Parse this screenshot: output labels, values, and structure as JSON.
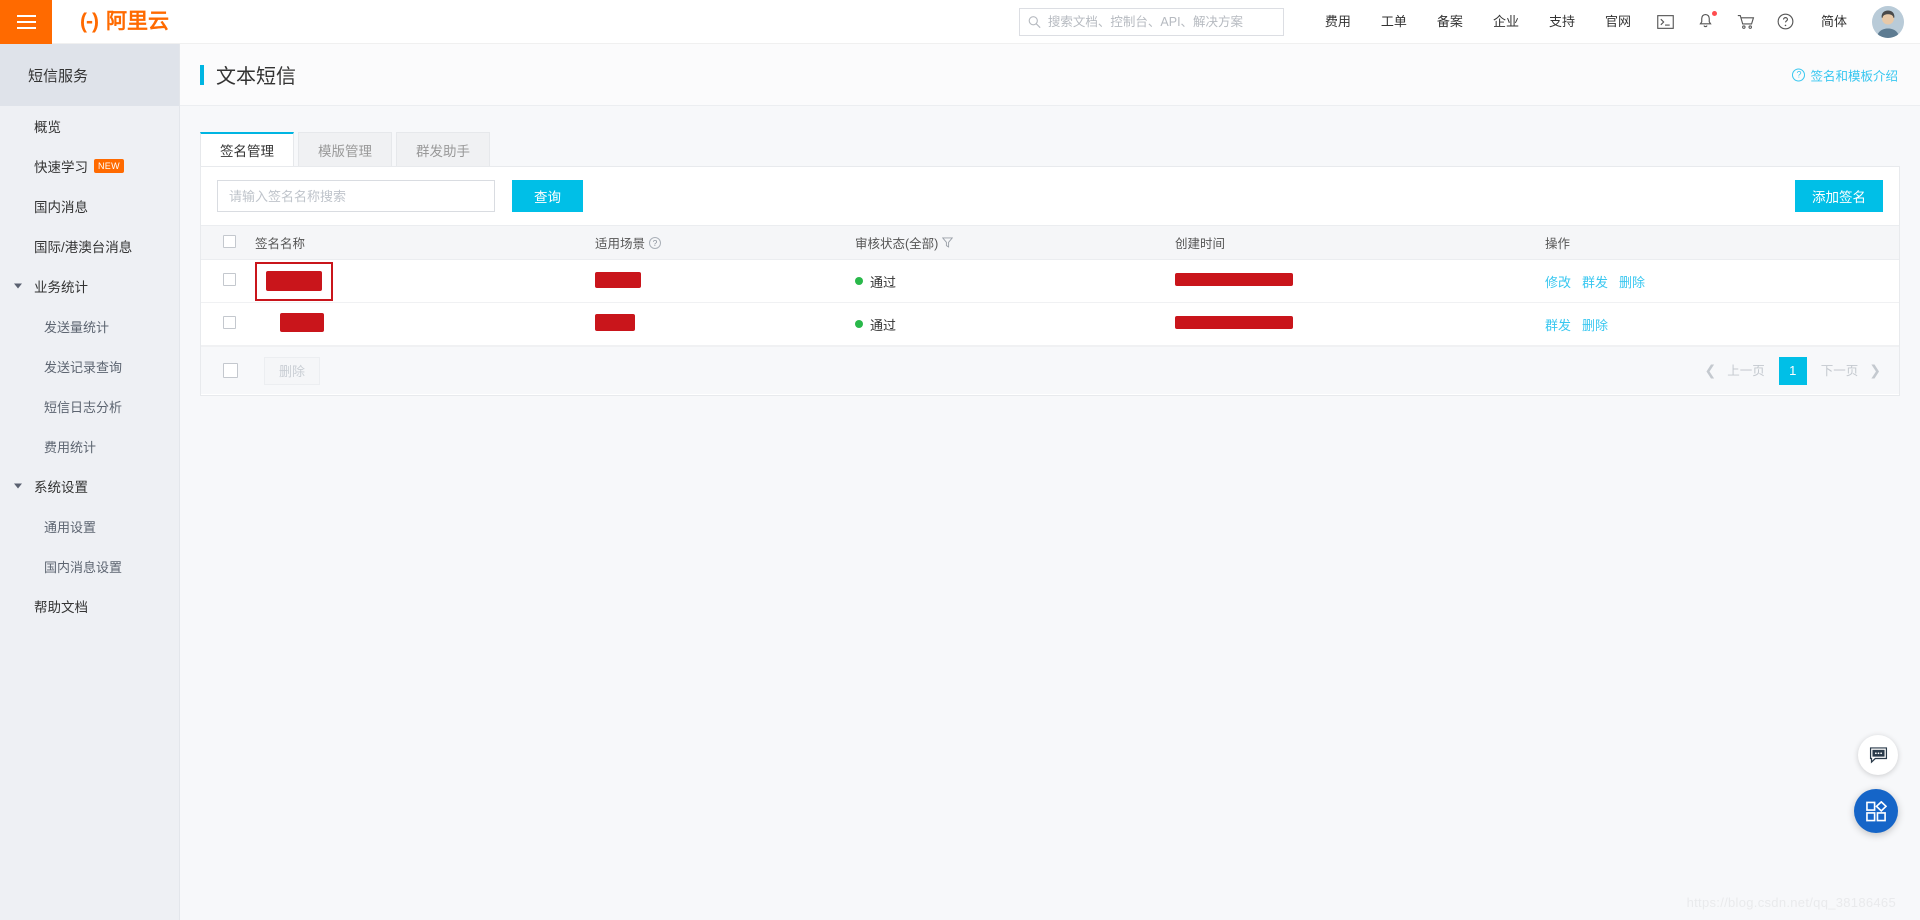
{
  "header": {
    "menu_icon": "hamburger-icon",
    "brand_mark": "(-)",
    "brand_name": "阿里云",
    "search_placeholder": "搜索文档、控制台、API、解决方案",
    "search_value": "",
    "search_icon": "search-icon",
    "nav_links": [
      "费用",
      "工单",
      "备案",
      "企业",
      "支持",
      "官网"
    ],
    "icons": [
      "terminal-icon",
      "bell-icon",
      "cart-icon",
      "help-icon"
    ],
    "language": "简体",
    "avatar": "user-avatar"
  },
  "sidebar": {
    "title": "短信服务",
    "items": [
      {
        "label": "概览",
        "type": "item"
      },
      {
        "label": "快速学习",
        "type": "item",
        "tag": "NEW"
      },
      {
        "label": "国内消息",
        "type": "item"
      },
      {
        "label": "国际/港澳台消息",
        "type": "item"
      },
      {
        "label": "业务统计",
        "type": "group"
      },
      {
        "label": "发送量统计",
        "type": "sub"
      },
      {
        "label": "发送记录查询",
        "type": "sub"
      },
      {
        "label": "短信日志分析",
        "type": "sub"
      },
      {
        "label": "费用统计",
        "type": "sub"
      },
      {
        "label": "系统设置",
        "type": "group"
      },
      {
        "label": "通用设置",
        "type": "sub"
      },
      {
        "label": "国内消息设置",
        "type": "sub"
      },
      {
        "label": "帮助文档",
        "type": "item"
      }
    ]
  },
  "page": {
    "title": "文本短信",
    "accent_color": "#00b5e2",
    "help_link": "签名和模板介绍",
    "help_icon": "question-circle-icon"
  },
  "tabs": [
    {
      "label": "签名管理",
      "active": true
    },
    {
      "label": "模版管理",
      "active": false
    },
    {
      "label": "群发助手",
      "active": false
    }
  ],
  "toolbar": {
    "search_placeholder": "请输入签名名称搜索",
    "search_value": "",
    "query_label": "查询",
    "add_label": "添加签名"
  },
  "table": {
    "columns": [
      "签名名称",
      "适用场景",
      "审核状态(全部)",
      "创建时间",
      "操作"
    ],
    "scene_help_icon": "question-circle-icon",
    "status_filter_icon": "filter-icon",
    "rows": [
      {
        "name": "[redacted]",
        "name_highlighted": true,
        "scene": "[redacted]",
        "status": "通过",
        "status_color": "#29b84a",
        "created": "[redacted]",
        "actions": [
          "修改",
          "群发",
          "删除"
        ]
      },
      {
        "name": "[redacted]",
        "name_highlighted": false,
        "scene": "[redacted]",
        "status": "通过",
        "status_color": "#29b84a",
        "created": "[redacted]",
        "actions": [
          "群发",
          "删除"
        ]
      }
    ]
  },
  "footer": {
    "delete_label": "删除",
    "prev_label": "上一页",
    "next_label": "下一页",
    "current_page": "1"
  },
  "floating": {
    "chat_icon": "chat-bubble-icon",
    "grid_icon": "apps-grid-icon"
  },
  "watermark": "https://blog.csdn.net/qq_38186465"
}
